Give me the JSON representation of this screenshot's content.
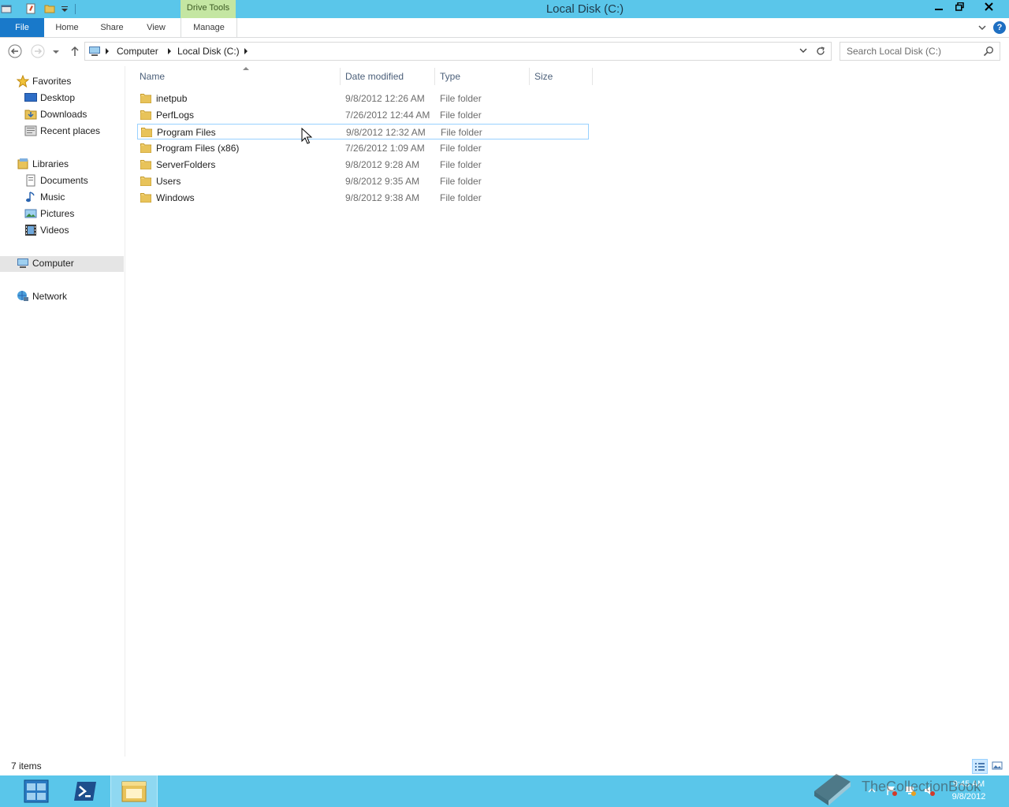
{
  "window": {
    "title": "Local Disk (C:)",
    "contextual_tab_group": "Drive Tools"
  },
  "ribbon": {
    "tabs": [
      {
        "label": "File"
      },
      {
        "label": "Home"
      },
      {
        "label": "Share"
      },
      {
        "label": "View"
      },
      {
        "label": "Manage"
      }
    ]
  },
  "address_bar": {
    "crumbs": [
      "Computer",
      "Local Disk (C:)"
    ]
  },
  "search": {
    "placeholder": "Search Local Disk (C:)"
  },
  "nav_pane": {
    "favorites": {
      "label": "Favorites",
      "items": [
        "Desktop",
        "Downloads",
        "Recent places"
      ]
    },
    "libraries": {
      "label": "Libraries",
      "items": [
        "Documents",
        "Music",
        "Pictures",
        "Videos"
      ]
    },
    "computer": "Computer",
    "network": "Network"
  },
  "file_list": {
    "columns": [
      "Name",
      "Date modified",
      "Type",
      "Size"
    ],
    "rows": [
      {
        "name": "inetpub",
        "date": "9/8/2012 12:26 AM",
        "type": "File folder",
        "size": ""
      },
      {
        "name": "PerfLogs",
        "date": "7/26/2012 12:44 AM",
        "type": "File folder",
        "size": ""
      },
      {
        "name": "Program Files",
        "date": "9/8/2012 12:32 AM",
        "type": "File folder",
        "size": ""
      },
      {
        "name": "Program Files (x86)",
        "date": "7/26/2012 1:09 AM",
        "type": "File folder",
        "size": ""
      },
      {
        "name": "ServerFolders",
        "date": "9/8/2012 9:28 AM",
        "type": "File folder",
        "size": ""
      },
      {
        "name": "Users",
        "date": "9/8/2012 9:35 AM",
        "type": "File folder",
        "size": ""
      },
      {
        "name": "Windows",
        "date": "9/8/2012 9:38 AM",
        "type": "File folder",
        "size": ""
      }
    ],
    "selected_row": "Program Files"
  },
  "status_bar": {
    "item_count": "7 items"
  },
  "taskbar": {
    "clock_time": "9:45 AM",
    "clock_date": "9/8/2012",
    "apps": [
      "start-icon",
      "powershell-icon",
      "file-explorer-icon"
    ]
  },
  "watermark": {
    "text": "TheCollectionBook"
  },
  "colors": {
    "title_bar": "#5ac6ea",
    "file_tab": "#1979ca",
    "drive_tools": "#c4e6a2",
    "selection_border": "#99d1ff",
    "taskbar": "#5ac6ea"
  }
}
